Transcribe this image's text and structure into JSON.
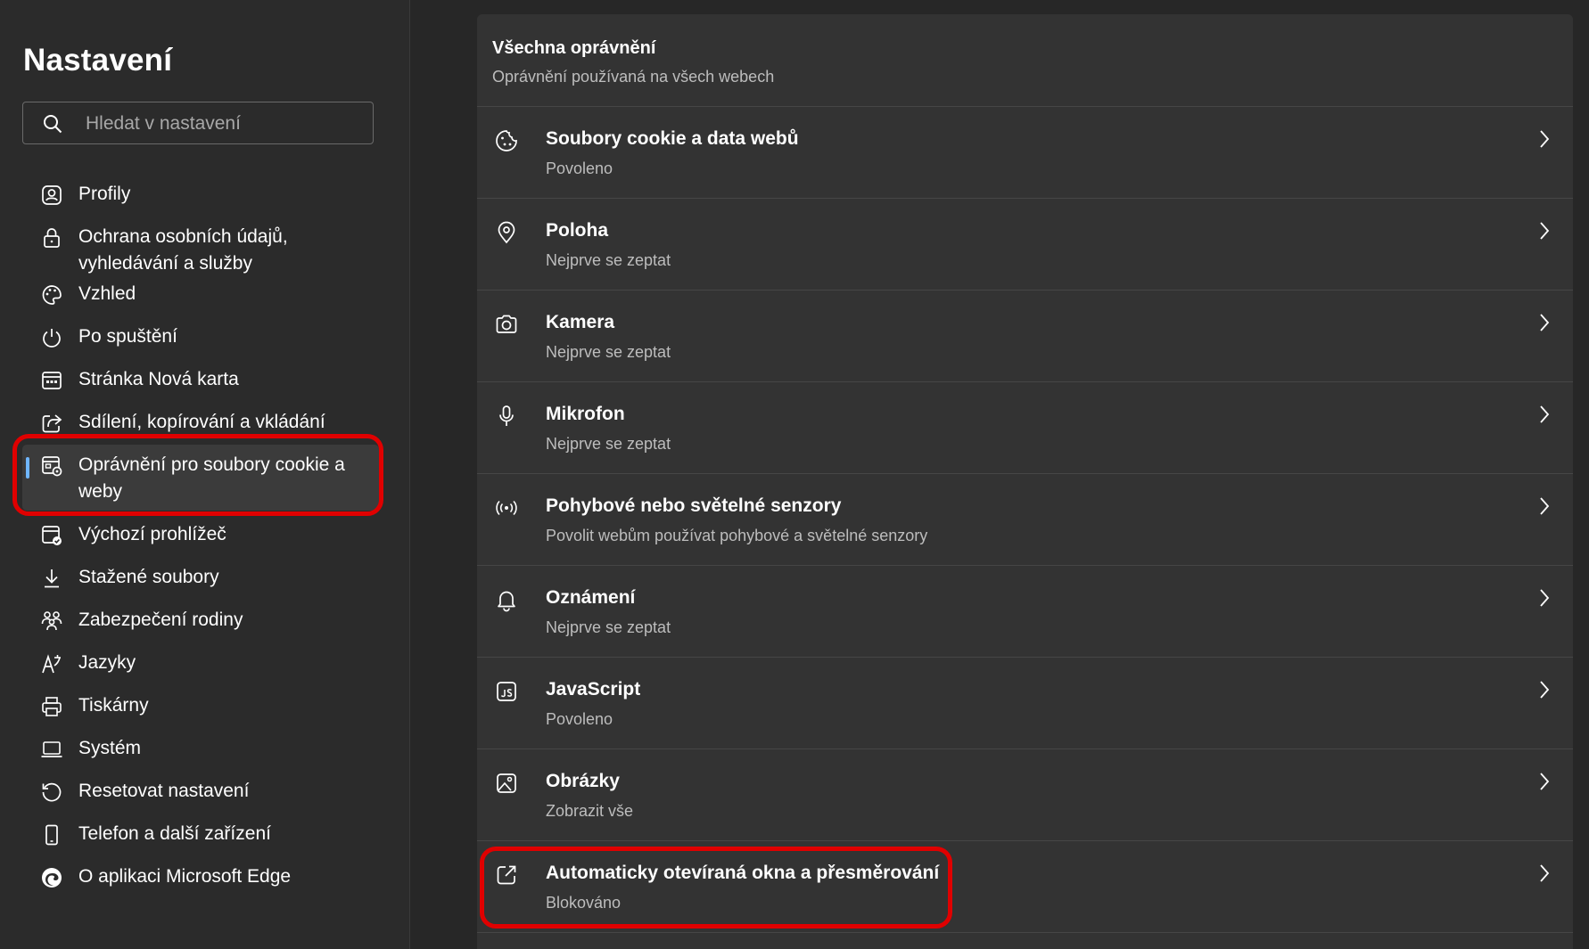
{
  "sidebar": {
    "title": "Nastavení",
    "search": {
      "placeholder": "Hledat v nastavení"
    },
    "items": [
      {
        "label": "Profily",
        "icon": "profile-icon"
      },
      {
        "label": "Ochrana osobních údajů, vyhledávání a služby",
        "icon": "lock-icon"
      },
      {
        "label": "Vzhled",
        "icon": "palette-icon"
      },
      {
        "label": "Po spuštění",
        "icon": "power-icon"
      },
      {
        "label": "Stránka Nová karta",
        "icon": "new-tab-icon"
      },
      {
        "label": "Sdílení, kopírování a vkládání",
        "icon": "share-icon"
      },
      {
        "label": "Oprávnění pro soubory cookie a weby",
        "icon": "site-permissions-icon",
        "active": true
      },
      {
        "label": "Výchozí prohlížeč",
        "icon": "default-browser-icon"
      },
      {
        "label": "Stažené soubory",
        "icon": "download-icon"
      },
      {
        "label": "Zabezpečení rodiny",
        "icon": "family-icon"
      },
      {
        "label": "Jazyky",
        "icon": "language-icon"
      },
      {
        "label": "Tiskárny",
        "icon": "printer-icon"
      },
      {
        "label": "Systém",
        "icon": "laptop-icon"
      },
      {
        "label": "Resetovat nastavení",
        "icon": "reset-icon"
      },
      {
        "label": "Telefon a další zařízení",
        "icon": "phone-icon"
      },
      {
        "label": "O aplikaci Microsoft Edge",
        "icon": "edge-logo-icon"
      }
    ]
  },
  "main": {
    "section": {
      "title": "Všechna oprávnění",
      "subtitle": "Oprávnění používaná na všech webech"
    },
    "permissions": [
      {
        "title": "Soubory cookie a data webů",
        "status": "Povoleno",
        "icon": "cookie-icon"
      },
      {
        "title": "Poloha",
        "status": "Nejprve se zeptat",
        "icon": "location-icon"
      },
      {
        "title": "Kamera",
        "status": "Nejprve se zeptat",
        "icon": "camera-icon"
      },
      {
        "title": "Mikrofon",
        "status": "Nejprve se zeptat",
        "icon": "microphone-icon"
      },
      {
        "title": "Pohybové nebo světelné senzory",
        "status": "Povolit webům používat pohybové a světelné senzory",
        "icon": "sensor-icon"
      },
      {
        "title": "Oznámení",
        "status": "Nejprve se zeptat",
        "icon": "bell-icon"
      },
      {
        "title": "JavaScript",
        "status": "Povoleno",
        "icon": "javascript-icon"
      },
      {
        "title": "Obrázky",
        "status": "Zobrazit vše",
        "icon": "image-icon"
      },
      {
        "title": "Automaticky otevíraná okna a přesměrování",
        "status": "Blokováno",
        "icon": "popup-icon"
      }
    ]
  },
  "colors": {
    "background": "#272727",
    "sidebar": "#2b2b2b",
    "card": "#333333",
    "accent": "#6fb6ff",
    "highlight": "#e00000"
  }
}
